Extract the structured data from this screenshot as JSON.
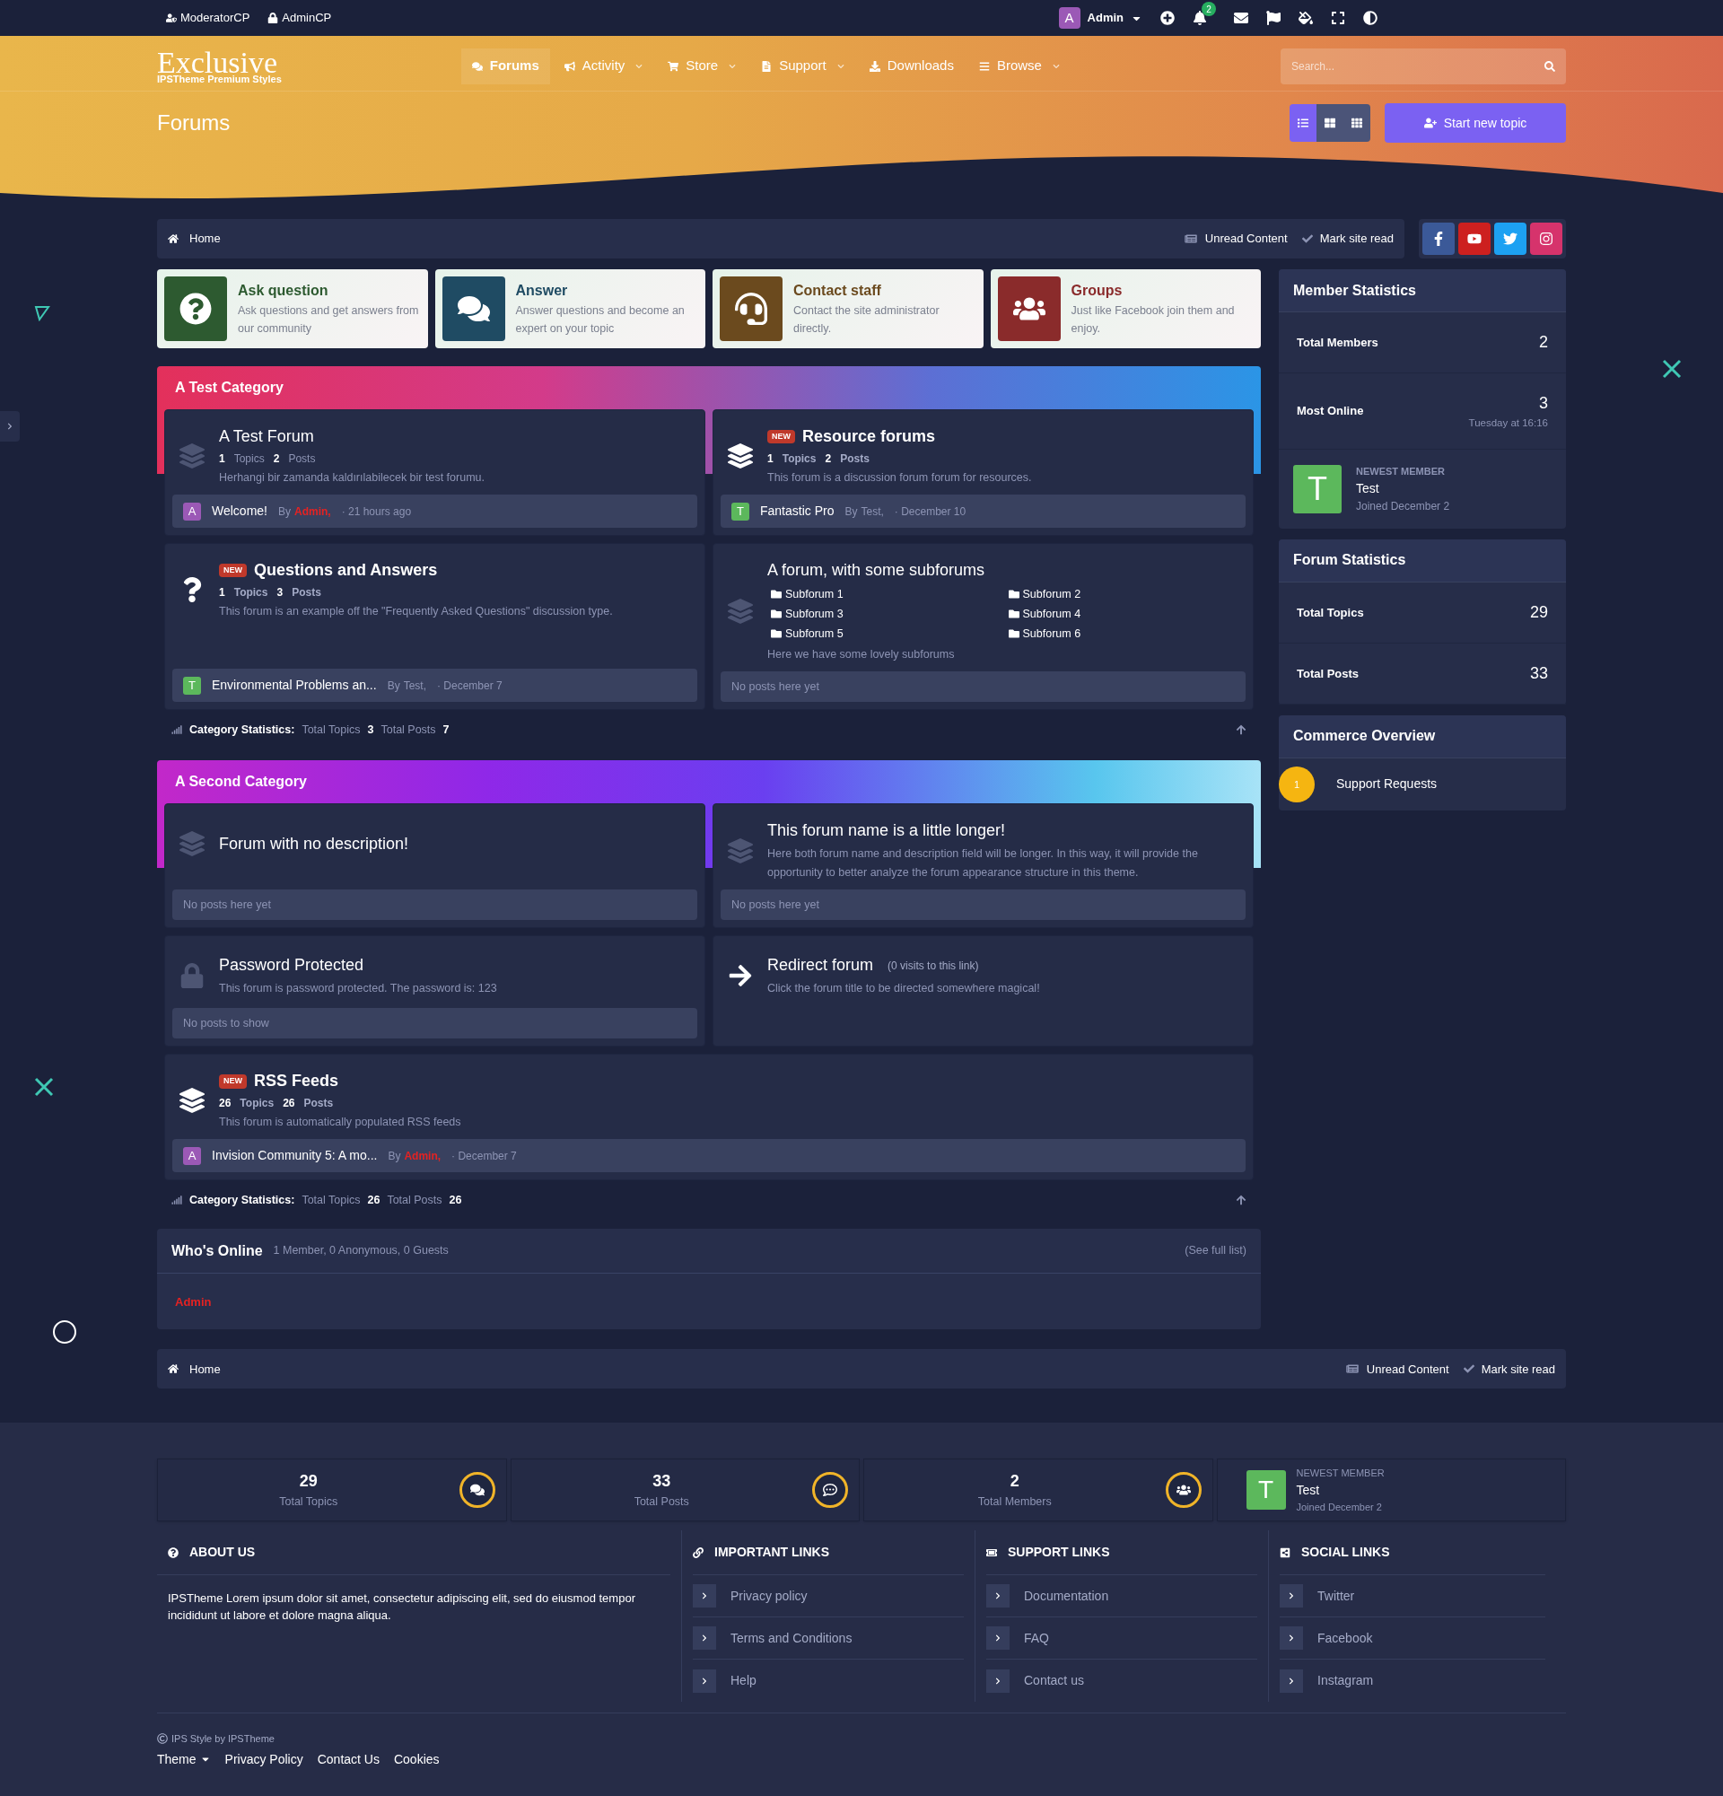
{
  "topbar": {
    "links": [
      "ModeratorCP",
      "AdminCP"
    ],
    "user": {
      "initial": "A",
      "name": "Admin"
    },
    "notification_count": "2"
  },
  "nav": {
    "logo": {
      "title": "Exclusive",
      "subtitle": "IPSTheme Premium Styles"
    },
    "items": [
      {
        "label": "Forums",
        "selected": true,
        "dropdown": false
      },
      {
        "label": "Activity",
        "selected": false,
        "dropdown": true
      },
      {
        "label": "Store",
        "selected": false,
        "dropdown": true
      },
      {
        "label": "Support",
        "selected": false,
        "dropdown": true
      },
      {
        "label": "Downloads",
        "selected": false,
        "dropdown": false
      },
      {
        "label": "Browse",
        "selected": false,
        "dropdown": true
      }
    ],
    "search": {
      "placeholder": "Search..."
    }
  },
  "page_title": "Forums",
  "view_toggles": [
    {
      "selected": true
    },
    {
      "selected": false
    },
    {
      "selected": false
    }
  ],
  "start_button": "Start new topic",
  "breadcrumb": {
    "home": "Home",
    "actions": [
      "Unread Content",
      "Mark site read"
    ]
  },
  "feature_cards": [
    {
      "kind": "question",
      "title": "Ask question",
      "description": "Ask questions and get answers from our community",
      "color": "#2d5a30"
    },
    {
      "kind": "chat",
      "title": "Answer",
      "description": "Answer questions and become an expert on your topic",
      "color": "#1f4b63"
    },
    {
      "kind": "headset",
      "title": "Contact staff",
      "description": "Contact the site administrator directly.",
      "color": "#6b4a1e"
    },
    {
      "kind": "group",
      "title": "Groups",
      "description": "Just like Facebook join them and enjoy.",
      "color": "#8a2b2b"
    }
  ],
  "categories": [
    {
      "title": "A Test Category",
      "forums": [
        {
          "kind": "standard",
          "unread": false,
          "is_new": false,
          "name": "A Test Forum",
          "topics": "1",
          "topics_label": "Topics",
          "posts": "2",
          "posts_label": "Posts",
          "description": "Herhangi bir zamanda kaldırılabilecek bir test forumu.",
          "last_post": {
            "initial": "A",
            "color": "#9b59b6",
            "title": "Welcome!",
            "by": "By",
            "author": "Admin,",
            "author_highlight": true,
            "time": "· 21 hours ago"
          }
        },
        {
          "kind": "standard",
          "unread": true,
          "is_new": true,
          "new_label": "NEW",
          "name": "Resource forums",
          "topics": "1",
          "topics_label": "Topics",
          "posts": "2",
          "posts_label": "Posts",
          "description": "This forum is a discussion forum forum for resources.",
          "last_post": {
            "initial": "T",
            "color": "#5cb85c",
            "title": "Fantastic Pro",
            "by": "By",
            "author": "Test,",
            "author_highlight": false,
            "time": "· December 10"
          }
        },
        {
          "kind": "question",
          "unread": true,
          "is_new": true,
          "new_label": "NEW",
          "name": "Questions and Answers",
          "topics": "1",
          "topics_label": "Topics",
          "posts": "3",
          "posts_label": "Posts",
          "description": "This forum is an example off the \"Frequently Asked Questions\" discussion type.",
          "last_post": {
            "initial": "T",
            "color": "#5cb85c",
            "title": "Environmental Problems an...",
            "by": "By",
            "author": "Test,",
            "author_highlight": false,
            "time": "· December 7"
          }
        },
        {
          "kind": "standard",
          "unread": false,
          "is_new": false,
          "name": "A forum, with some subforums",
          "subforums": [
            "Subforum 1",
            "Subforum 2",
            "Subforum 3",
            "Subforum 4",
            "Subforum 5",
            "Subforum 6"
          ],
          "description": "Here we have some lovely subforums",
          "empty_text": "No posts here yet"
        }
      ],
      "stats": {
        "label": "Category Statistics:",
        "topics_label": "Total Topics",
        "topics": "3",
        "posts_label": "Total Posts",
        "posts": "7"
      }
    },
    {
      "title": "A Second Category",
      "forums": [
        {
          "kind": "standard",
          "unread": false,
          "is_new": false,
          "name": "Forum with no description!",
          "empty_text": "No posts here yet"
        },
        {
          "kind": "standard",
          "unread": false,
          "is_new": false,
          "name": "This forum name is a little longer!",
          "description": "Here both forum name and description field will be longer. In this way, it will provide the opportunity to better analyze the forum appearance structure in this theme.",
          "empty_text": "No posts here yet"
        },
        {
          "kind": "password",
          "unread": false,
          "is_new": false,
          "name": "Password Protected",
          "description": "This forum is password protected. The password is: 123",
          "empty_text": "No posts to show"
        },
        {
          "kind": "redirect",
          "unread": true,
          "is_new": false,
          "name": "Redirect forum",
          "visits": "(0 visits to this link)",
          "description": "Click the forum title to be directed somewhere magical!"
        },
        {
          "kind": "standard",
          "wide": true,
          "unread": true,
          "is_new": true,
          "new_label": "NEW",
          "name": "RSS Feeds",
          "topics": "26",
          "topics_label": "Topics",
          "posts": "26",
          "posts_label": "Posts",
          "description": "This forum is automatically populated RSS feeds",
          "last_post": {
            "initial": "A",
            "color": "#9b59b6",
            "title": "Invision Community 5: A mo...",
            "by": "By",
            "author": "Admin,",
            "author_highlight": true,
            "time": "· December 7"
          }
        }
      ],
      "stats": {
        "label": "Category Statistics:",
        "topics_label": "Total Topics",
        "topics": "26",
        "posts_label": "Total Posts",
        "posts": "26"
      }
    }
  ],
  "whos_online": {
    "title": "Who's Online",
    "summary": "1 Member, 0 Anonymous, 0 Guests",
    "see_all": "(See full list)",
    "members": [
      {
        "name": "Admin"
      }
    ]
  },
  "sidebar": {
    "member_stats": {
      "title": "Member Statistics",
      "rows": [
        {
          "label": "Total Members",
          "value": "2"
        },
        {
          "label": "Most Online",
          "value": "3",
          "sub": "Tuesday at 16:16"
        }
      ],
      "newest": {
        "label": "NEWEST MEMBER",
        "initial": "T",
        "name": "Test",
        "joined": "Joined December 2"
      }
    },
    "forum_stats": {
      "title": "Forum Statistics",
      "rows": [
        {
          "label": "Total Topics",
          "value": "29"
        },
        {
          "label": "Total Posts",
          "value": "33"
        }
      ]
    },
    "commerce": {
      "title": "Commerce Overview",
      "items": [
        {
          "count": "1",
          "label": "Support Requests"
        }
      ]
    }
  },
  "bottom_breadcrumb": {
    "home": "Home",
    "actions": [
      "Unread Content",
      "Mark site read"
    ]
  },
  "footer_stats": [
    {
      "kind": "topics",
      "value": "29",
      "label": "Total Topics"
    },
    {
      "kind": "posts",
      "value": "33",
      "label": "Total Posts"
    },
    {
      "kind": "members",
      "value": "2",
      "label": "Total Members"
    }
  ],
  "footer_newest": {
    "label": "NEWEST MEMBER",
    "initial": "T",
    "name": "Test",
    "joined": "Joined December 2"
  },
  "footer_about": {
    "title": "ABOUT US",
    "text": "IPSTheme Lorem ipsum dolor sit amet, consectetur adipiscing elit, sed do eiusmod tempor incididunt ut labore et dolore magna aliqua."
  },
  "footer_columns": [
    {
      "kind": "link",
      "title": "IMPORTANT LINKS",
      "items": [
        "Privacy policy",
        "Terms and Conditions",
        "Help"
      ]
    },
    {
      "kind": "support",
      "title": "SUPPORT LINKS",
      "items": [
        "Documentation",
        "FAQ",
        "Contact us"
      ]
    },
    {
      "kind": "social",
      "title": "SOCIAL LINKS",
      "items": [
        "Twitter",
        "Facebook",
        "Instagram"
      ]
    }
  ],
  "copyright": "IPS Style by IPSTheme",
  "bottom_links": [
    {
      "label": "Theme",
      "dropdown": true
    },
    {
      "label": "Privacy Policy",
      "dropdown": false
    },
    {
      "label": "Contact Us",
      "dropdown": false
    },
    {
      "label": "Cookies",
      "dropdown": false
    }
  ]
}
